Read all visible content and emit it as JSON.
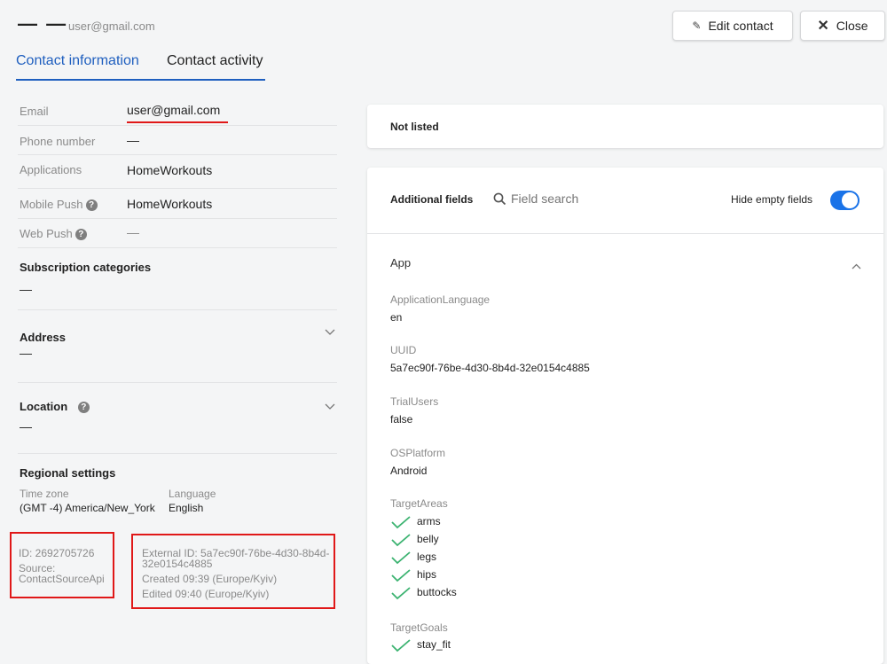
{
  "header": {
    "dashes": "— —",
    "email": "user@gmail.com",
    "edit_button": "Edit contact",
    "close_button": "Close"
  },
  "tabs": [
    {
      "label": "Contact information",
      "active": true
    },
    {
      "label": "Contact activity",
      "active": false
    }
  ],
  "contact": {
    "email_label": "Email",
    "email_value": "user@gmail.com",
    "phone_label": "Phone number",
    "phone_value": "—",
    "applications_label": "Applications",
    "applications_value": "HomeWorkouts",
    "mobile_push_label": "Mobile Push",
    "mobile_push_value": "HomeWorkouts",
    "web_push_label": "Web Push",
    "web_push_value": "—"
  },
  "sections": {
    "subscription_title": "Subscription categories",
    "subscription_value": "—",
    "address_title": "Address",
    "address_value": "—",
    "location_title": "Location",
    "location_value": "—",
    "regional_title": "Regional settings",
    "timezone_label": "Time zone",
    "timezone_value": "(GMT -4) America/New_York",
    "language_label": "Language",
    "language_value": "English"
  },
  "ids": {
    "id": "ID: 2692705726",
    "source_label": "Source:",
    "source_value": "ContactSourceApi",
    "external_id_line1": "External ID: 5a7ec90f-76be-4d30-8b4d-",
    "external_id_line2": "32e0154c4885",
    "created": "Created 09:39 (Europe/Kyiv)",
    "edited": "Edited 09:40 (Europe/Kyiv)"
  },
  "right": {
    "not_listed": "Not listed",
    "additional_fields": "Additional fields",
    "field_search_placeholder": "Field search",
    "hide_empty_label": "Hide empty fields",
    "hide_empty_on": true,
    "group_title": "App",
    "fields": {
      "app_language_label": "ApplicationLanguage",
      "app_language_value": "en",
      "uuid_label": "UUID",
      "uuid_value": "5a7ec90f-76be-4d30-8b4d-32e0154c4885",
      "trial_label": "TrialUsers",
      "trial_value": "false",
      "os_label": "OSPlatform",
      "os_value": "Android",
      "target_areas_label": "TargetAreas",
      "target_areas": [
        "arms",
        "belly",
        "legs",
        "hips",
        "buttocks"
      ],
      "target_goals_label": "TargetGoals",
      "target_goals": [
        "stay_fit"
      ]
    }
  },
  "colors": {
    "accent": "#1a73e8",
    "tab_active": "#1f5fbf",
    "check": "#3cb371",
    "highlight": "#e01818"
  }
}
